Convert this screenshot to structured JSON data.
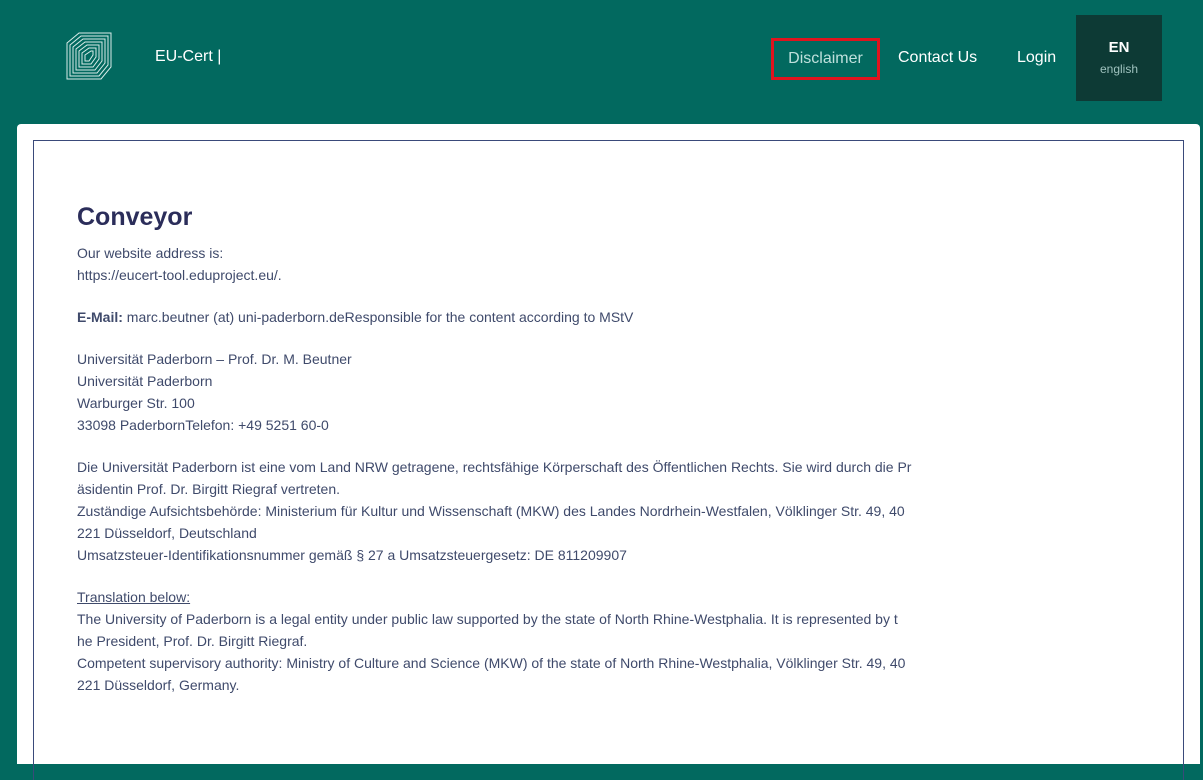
{
  "header": {
    "brand": "EU-Cert |",
    "nav": {
      "disclaimer": "Disclaimer",
      "contact": "Contact Us",
      "login": "Login"
    },
    "lang": {
      "code": "EN",
      "name": "english"
    }
  },
  "colors": {
    "header_bg": "#02695f",
    "lang_bg": "#0d3a35",
    "highlight_border": "#e0141e",
    "title": "#2b2d5a",
    "text": "#3f4a6b"
  },
  "main": {
    "title": "Conveyor",
    "website_line1": "Our website address is:",
    "website_line2": "https://eucert-tool.eduproject.eu/.",
    "email_label": "E-Mail:",
    "email_text": " marc.beutner (at) uni-paderborn.deResponsible for the content according to MStV",
    "address": [
      "Universität Paderborn – Prof. Dr. M. Beutner",
      "Universität Paderborn",
      "Warburger Str. 100",
      "33098 PaderbornTelefon: +49 5251 60-0"
    ],
    "german": [
      "Die Universität Paderborn ist eine vom Land NRW getragene, rechtsfähige Körperschaft des Öffentlichen Rechts. Sie wird durch die Pr",
      "äsidentin Prof. Dr. Birgitt Riegraf vertreten.",
      "Zuständige Aufsichtsbehörde: Ministerium für Kultur und Wissenschaft (MKW) des Landes Nordrhein-Westfalen, Völklinger Str. 49, 40",
      "221 Düsseldorf, Deutschland",
      "Umsatzsteuer-Identifikationsnummer gemäß § 27 a Umsatzsteuergesetz: DE 811209907"
    ],
    "translation_label": "Translation below:",
    "english": [
      "The University of Paderborn is a legal entity under public law supported by the state of North Rhine-Westphalia. It is represented by t",
      "he President, Prof. Dr. Birgitt Riegraf.",
      "Competent supervisory authority: Ministry of Culture and Science (MKW) of the state of North Rhine-Westphalia, Völklinger Str. 49, 40",
      "221 Düsseldorf, Germany."
    ]
  }
}
